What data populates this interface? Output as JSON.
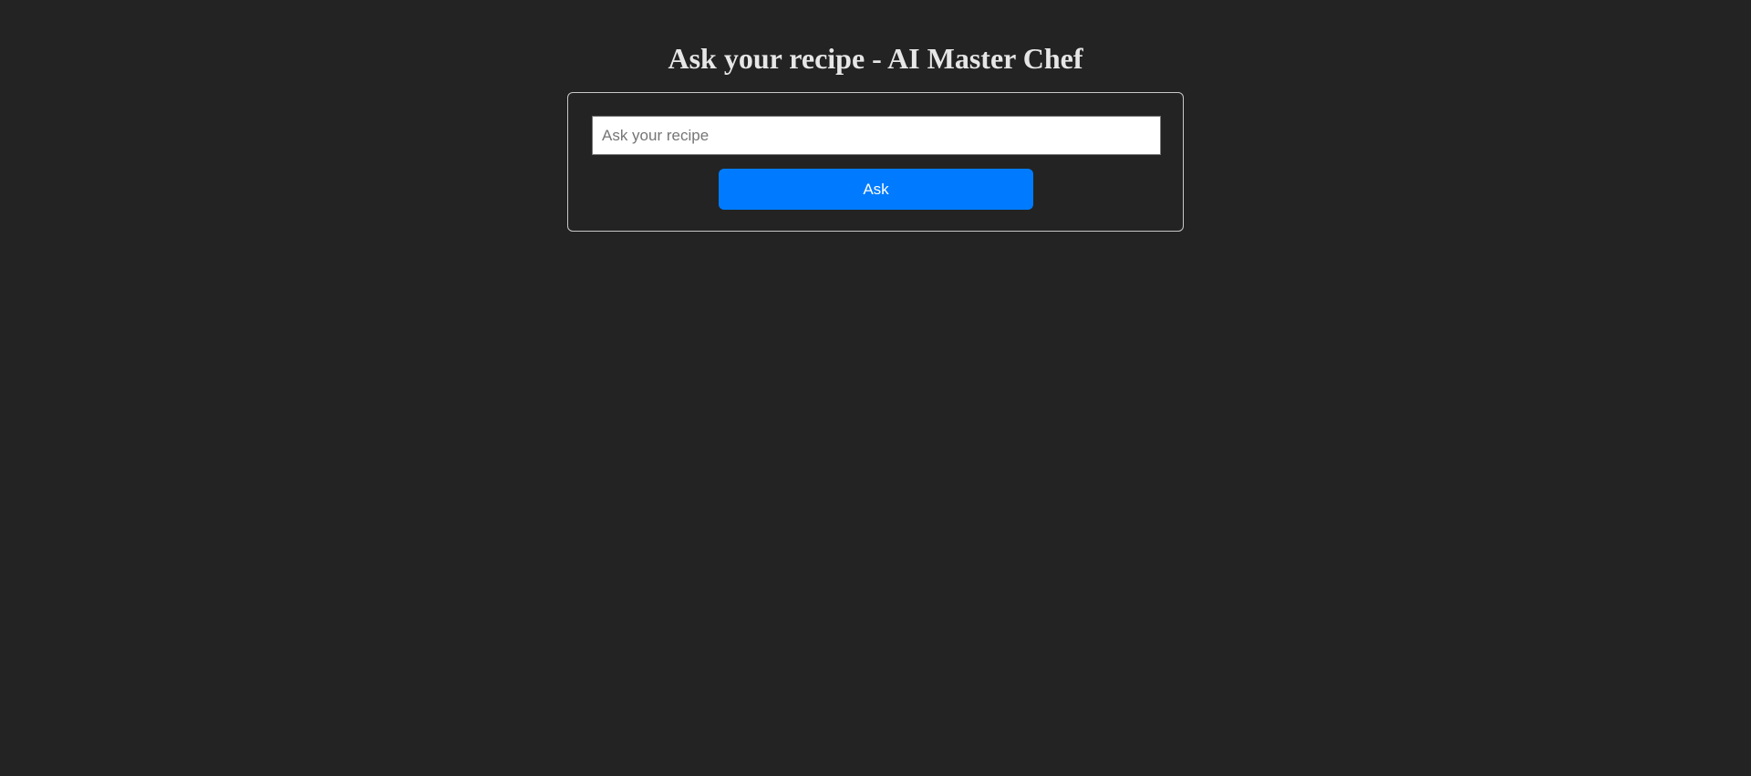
{
  "header": {
    "title": "Ask your recipe - AI Master Chef"
  },
  "form": {
    "input_value": "",
    "input_placeholder": "Ask your recipe",
    "submit_label": "Ask"
  },
  "colors": {
    "background": "#232323",
    "accent": "#007bff"
  }
}
